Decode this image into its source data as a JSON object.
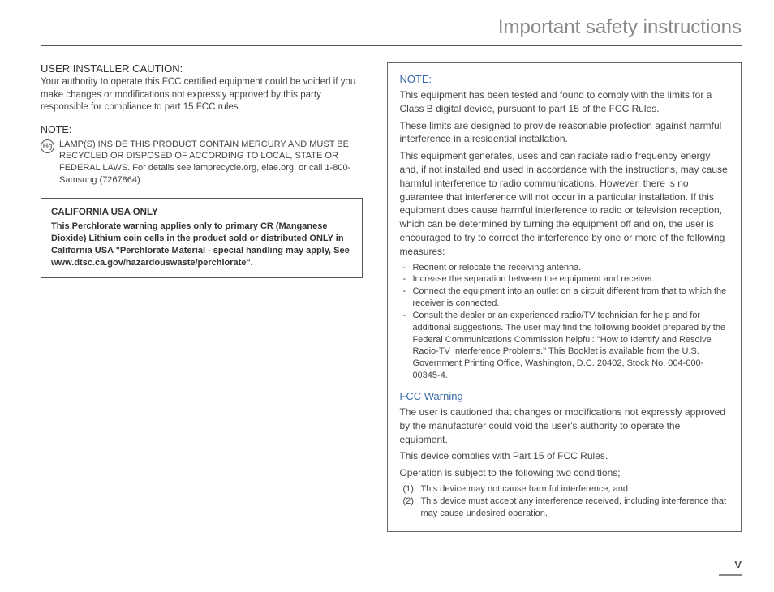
{
  "title": "Important safety instructions",
  "left": {
    "installer_heading": "USER INSTALLER CAUTION:",
    "installer_body": "Your authority to operate this FCC certified equipment could be voided if you make changes or modifications not expressly approved by this party responsible for compliance to part 15 FCC rules.",
    "note_label": "NOTE:",
    "hg_symbol": "Hg",
    "hg_text": "LAMP(S) INSIDE THIS PRODUCT CONTAIN MERCURY AND MUST BE RECYCLED OR DISPOSED OF ACCORDING TO LOCAL, STATE OR FEDERAL LAWS. For details see lamprecycle.org, eiae.org, or call 1-800-Samsung (7267864)",
    "box_title": "CALIFORNIA USA ONLY",
    "box_body": "This Perchlorate warning applies only to primary CR (Manganese Dioxide) Lithium coin cells in the product sold or distributed ONLY in California USA \"Perchlorate Material - special handling may apply, See www.dtsc.ca.gov/hazardouswaste/perchlorate\"."
  },
  "right": {
    "note_label": "NOTE:",
    "p1": "This equipment has been tested and found to comply with the limits for a Class B digital device, pursuant to part 15 of the FCC Rules.",
    "p2": "These limits are designed to provide reasonable protection against harmful interference in a residential installation.",
    "p3": "This equipment generates, uses and can radiate radio frequency energy and, if not installed and used in accordance with the instructions, may cause harmful interference to radio communications. However, there is no guarantee that interference will not occur in a particular installation. If this equipment does cause harmful interference to radio or television reception, which can be determined by turning the equipment off and on, the user is encouraged to try to correct the interference by one or more of the following measures:",
    "bullets": [
      "Reorient or relocate the receiving antenna.",
      "Increase the separation between the equipment and receiver.",
      "Connect the equipment into an outlet on a circuit different from that to which the receiver is connected.",
      "Consult the dealer or an experienced radio/TV technician for help and for additional suggestions. The user may find the following booklet prepared by the Federal Communications Commission helpful: \"How to Identify and Resolve Radio-TV Interference Problems.\" This Booklet is available from the U.S. Government Printing Office, Washington, D.C. 20402, Stock No. 004-000-00345-4."
    ],
    "fcc_heading": "FCC Warning",
    "fcc_p1": "The user is cautioned that changes or modifications not expressly approved by the manufacturer could void the user's authority to operate the equipment.",
    "fcc_p2": "This device complies with Part 15 of FCC Rules.",
    "fcc_p3": "Operation is subject to the following two conditions;",
    "conditions": [
      {
        "num": "(1)",
        "text": "This device may not cause harmful interference, and"
      },
      {
        "num": "(2)",
        "text": "This device must accept any interference received, including interference that may cause undesired operation."
      }
    ]
  },
  "page_number": "V"
}
